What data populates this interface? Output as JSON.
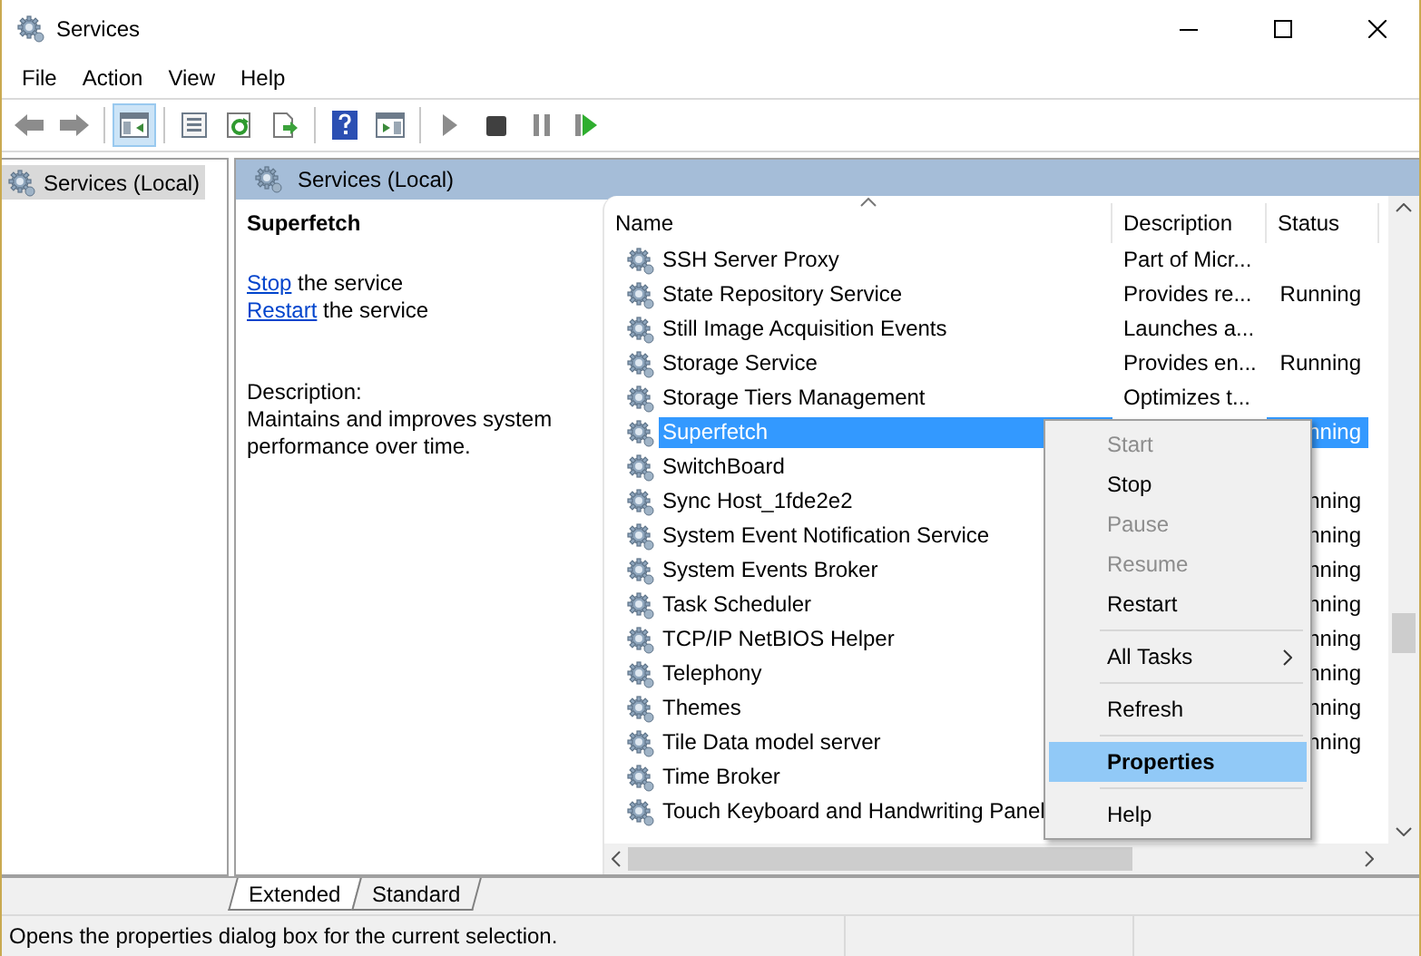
{
  "window": {
    "title": "Services"
  },
  "menu_bar": [
    "File",
    "Action",
    "View",
    "Help"
  ],
  "toolbar": [
    {
      "kind": "back",
      "pressed": false
    },
    {
      "kind": "forward",
      "pressed": false
    },
    {
      "kind": "sep"
    },
    {
      "kind": "tree",
      "pressed": true
    },
    {
      "kind": "sep"
    },
    {
      "kind": "properties",
      "pressed": false
    },
    {
      "kind": "refresh",
      "pressed": false
    },
    {
      "kind": "export",
      "pressed": false
    },
    {
      "kind": "sep"
    },
    {
      "kind": "help",
      "pressed": false
    },
    {
      "kind": "actionpane",
      "pressed": false
    },
    {
      "kind": "sep"
    },
    {
      "kind": "play",
      "pressed": false
    },
    {
      "kind": "stop",
      "pressed": false
    },
    {
      "kind": "pause",
      "pressed": false
    },
    {
      "kind": "resume",
      "pressed": false
    }
  ],
  "tree": {
    "label": "Services (Local)",
    "selected": true
  },
  "pane_header": "Services (Local)",
  "details": {
    "title": "Superfetch",
    "actions": [
      {
        "link": "Stop",
        "text": "the service"
      },
      {
        "link": "Restart",
        "text": "the service"
      }
    ],
    "description_label": "Description:",
    "description": "Maintains and improves system performance over time."
  },
  "table": {
    "columns": [
      "Name",
      "Description",
      "Status"
    ],
    "rows": [
      {
        "name": "SSH Server Proxy",
        "description": "Part of Micr...",
        "status": "",
        "selected": false
      },
      {
        "name": "State Repository Service",
        "description": "Provides re...",
        "status": "Running",
        "selected": false
      },
      {
        "name": "Still Image Acquisition Events",
        "description": "Launches a...",
        "status": "",
        "selected": false
      },
      {
        "name": "Storage Service",
        "description": "Provides en...",
        "status": "Running",
        "selected": false
      },
      {
        "name": "Storage Tiers Management",
        "description": "Optimizes t...",
        "status": "",
        "selected": false
      },
      {
        "name": "Superfetch",
        "description": "",
        "status": "nning",
        "selected": true
      },
      {
        "name": "SwitchBoard",
        "description": "",
        "status": "",
        "selected": false
      },
      {
        "name": "Sync Host_1fde2e2",
        "description": "",
        "status": "nning",
        "selected": false
      },
      {
        "name": "System Event Notification Service",
        "description": "",
        "status": "nning",
        "selected": false
      },
      {
        "name": "System Events Broker",
        "description": "",
        "status": "nning",
        "selected": false
      },
      {
        "name": "Task Scheduler",
        "description": "",
        "status": "nning",
        "selected": false
      },
      {
        "name": "TCP/IP NetBIOS Helper",
        "description": "",
        "status": "nning",
        "selected": false
      },
      {
        "name": "Telephony",
        "description": "",
        "status": "nning",
        "selected": false
      },
      {
        "name": "Themes",
        "description": "",
        "status": "nning",
        "selected": false
      },
      {
        "name": "Tile Data model server",
        "description": "",
        "status": "nning",
        "selected": false
      },
      {
        "name": "Time Broker",
        "description": "",
        "status": "",
        "selected": false
      },
      {
        "name": "Touch Keyboard and Handwriting Panel",
        "description": "",
        "status": "",
        "selected": false
      }
    ]
  },
  "context_menu": [
    {
      "kind": "item",
      "label": "Start",
      "disabled": true,
      "selected": false
    },
    {
      "kind": "item",
      "label": "Stop",
      "disabled": false,
      "selected": false
    },
    {
      "kind": "item",
      "label": "Pause",
      "disabled": true,
      "selected": false
    },
    {
      "kind": "item",
      "label": "Resume",
      "disabled": true,
      "selected": false
    },
    {
      "kind": "item",
      "label": "Restart",
      "disabled": false,
      "selected": false
    },
    {
      "kind": "sep"
    },
    {
      "kind": "submenu",
      "label": "All Tasks",
      "disabled": false,
      "selected": false
    },
    {
      "kind": "sep"
    },
    {
      "kind": "item",
      "label": "Refresh",
      "disabled": false,
      "selected": false
    },
    {
      "kind": "sep"
    },
    {
      "kind": "default",
      "label": "Properties",
      "disabled": false,
      "selected": true
    },
    {
      "kind": "sep"
    },
    {
      "kind": "item",
      "label": "Help",
      "disabled": false,
      "selected": false
    }
  ],
  "view_tabs": [
    {
      "label": "Extended",
      "selected": true
    },
    {
      "label": "Standard",
      "selected": false
    }
  ],
  "status_bar": "Opens the properties dialog box for the current selection."
}
